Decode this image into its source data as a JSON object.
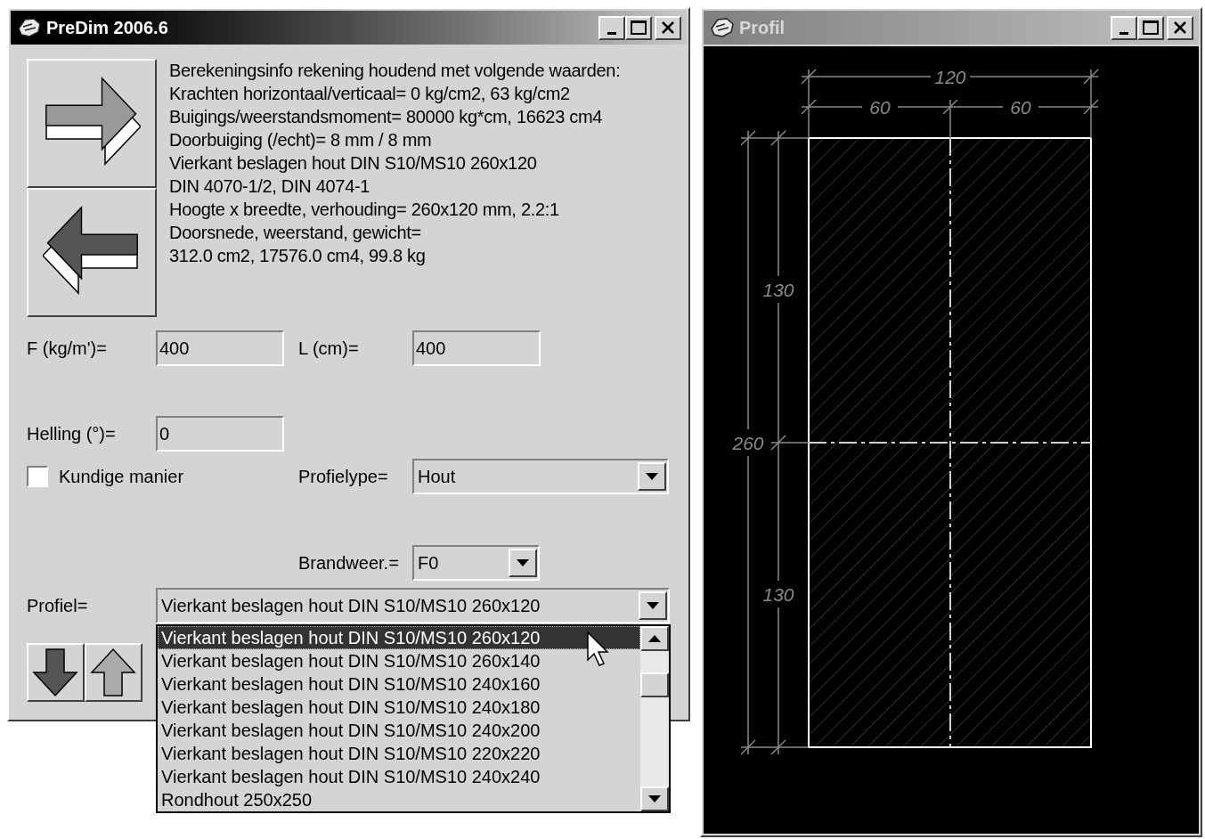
{
  "main_window": {
    "title": "PreDim 2006.6",
    "active": true
  },
  "info_lines": [
    "Berekeningsinfo rekening houdend met volgende waarden:",
    "Krachten horizontaal/verticaal= 0 kg/cm2, 63 kg/cm2",
    "Buigings/weerstandsmoment= 80000 kg*cm, 16623 cm4",
    "Doorbuiging (/echt)= 8 mm / 8 mm",
    "Vierkant beslagen hout DIN S10/MS10 260x120",
    "DIN 4070-1/2, DIN 4074-1",
    "Hoogte x breedte, verhouding= 260x120 mm, 2.2:1",
    "Doorsnede, weerstand, gewicht=",
    "312.0 cm2, 17576.0 cm4, 99.8 kg"
  ],
  "fields": [
    {
      "label": "F (kg/m')=",
      "value": "400"
    },
    {
      "label": "L (cm)=",
      "value": "400"
    },
    {
      "label": "Helling (°)=",
      "value": "0"
    }
  ],
  "checkbox": {
    "label": "Kundige manier",
    "checked": false
  },
  "profieltype": {
    "label": "Profielype=",
    "value": "Hout"
  },
  "brandweer": {
    "label": "Brandweer.=",
    "value": "F0"
  },
  "profiel": {
    "label": "Profiel=",
    "value": "Vierkant beslagen hout DIN S10/MS10 260x120",
    "expanded": true,
    "options": [
      {
        "label": "Vierkant beslagen hout DIN S10/MS10 260x120",
        "selected": true
      },
      {
        "label": "Vierkant beslagen hout DIN S10/MS10 260x140",
        "selected": false
      },
      {
        "label": "Vierkant beslagen hout DIN S10/MS10 240x160",
        "selected": false
      },
      {
        "label": "Vierkant beslagen hout DIN S10/MS10 240x180",
        "selected": false
      },
      {
        "label": "Vierkant beslagen hout DIN S10/MS10 240x200",
        "selected": false
      },
      {
        "label": "Vierkant beslagen hout DIN S10/MS10 220x220",
        "selected": false
      },
      {
        "label": "Vierkant beslagen hout DIN S10/MS10 240x240",
        "selected": false
      },
      {
        "label": "Rondhout 250x250",
        "selected": false
      }
    ]
  },
  "profile_window": {
    "title": "Profil",
    "active": false,
    "dimensions": {
      "width_total": "120",
      "width_parts": [
        "60",
        "60"
      ],
      "height_total": "260",
      "height_parts": [
        "130",
        "130"
      ]
    }
  }
}
